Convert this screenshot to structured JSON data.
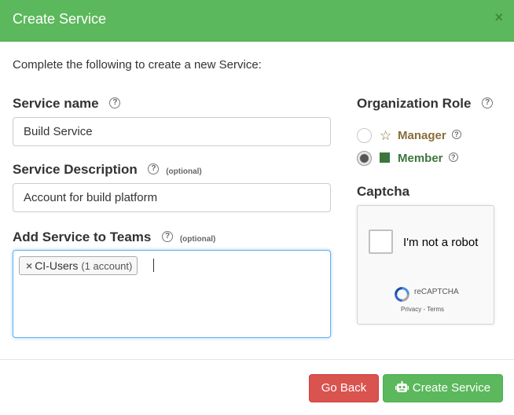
{
  "dialog": {
    "title": "Create Service",
    "close_symbol": "×"
  },
  "intro": "Complete the following to create a new Service:",
  "service_name": {
    "label": "Service name",
    "value": "Build Service"
  },
  "service_description": {
    "label": "Service Description",
    "optional": "(optional)",
    "value": "Account for build platform"
  },
  "teams": {
    "label": "Add Service to Teams",
    "optional": "(optional)",
    "tokens": [
      {
        "remove": "×",
        "name": "CI-Users",
        "detail": "(1 account)"
      }
    ]
  },
  "organization_role": {
    "label": "Organization Role",
    "options": [
      {
        "label": "Manager",
        "icon": "star-outline-icon",
        "color": "#8a6d3b",
        "selected": false
      },
      {
        "label": "Member",
        "icon": "square-icon",
        "color": "#3c763d",
        "selected": true
      }
    ]
  },
  "captcha": {
    "label": "Captcha",
    "checkbox_text": "I'm not a robot",
    "brand": "reCAPTCHA",
    "privacy": "Privacy",
    "separator": "-",
    "terms": "Terms"
  },
  "help_symbol": "?",
  "buttons": {
    "back": "Go Back",
    "create": "Create Service"
  },
  "colors": {
    "header": "#5cb85c",
    "danger": "#d9534f",
    "success": "#5cb85c",
    "focus": "#66afe9"
  }
}
